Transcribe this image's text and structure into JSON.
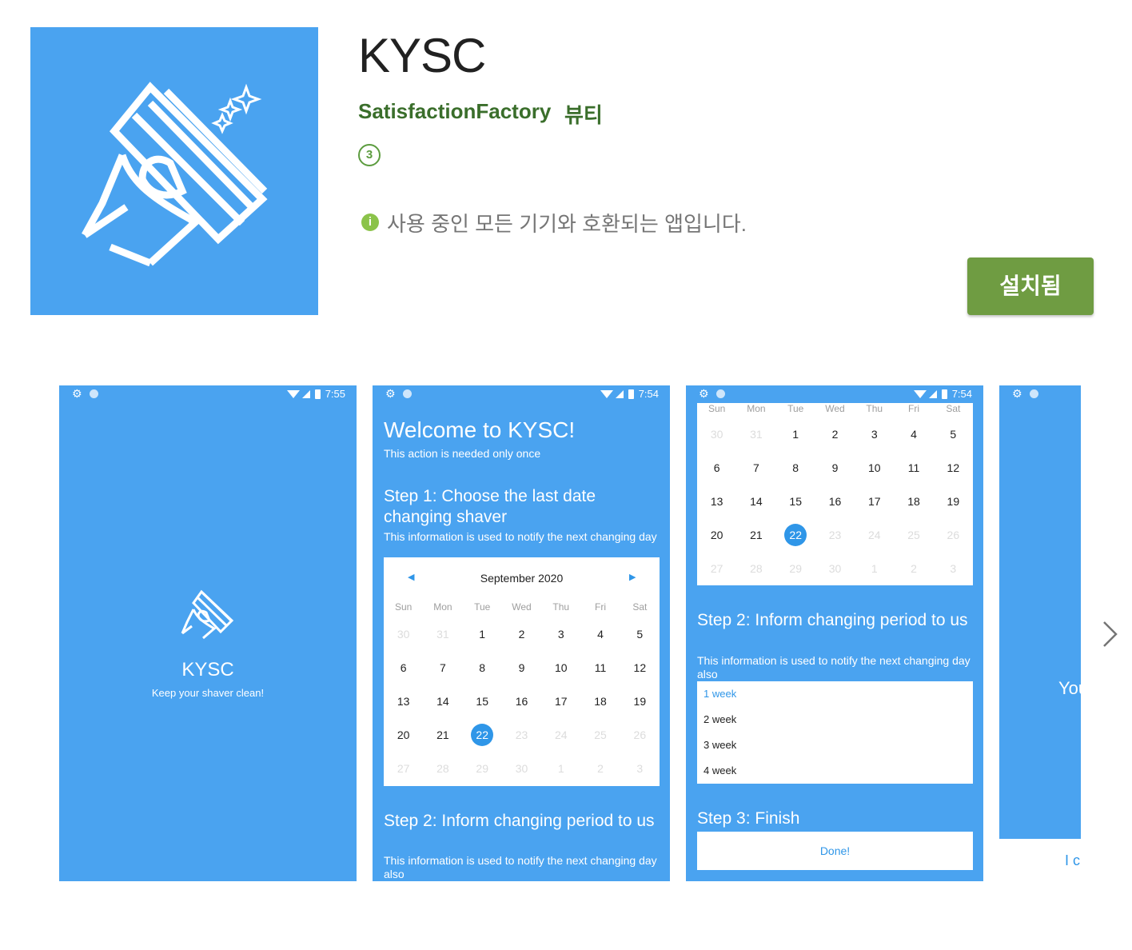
{
  "app": {
    "title": "KYSC",
    "developer": "SatisfactionFactory",
    "category": "뷰티",
    "rating_badge": "3",
    "compat_icon": "i",
    "compat_text": "사용 중인 모든 기기와 호환되는 앱입니다.",
    "install_label": "설치됨",
    "icon_name": "razor-icon",
    "colors": {
      "accent": "#4aa3f0",
      "developer_green": "#3a6e2b",
      "install_green": "#6f9c42"
    }
  },
  "screenshots": [
    {
      "time": "7:55",
      "app_name": "KYSC",
      "tagline": "Keep your shaver clean!"
    },
    {
      "time": "7:54",
      "welcome": "Welcome to KYSC!",
      "welcome_sub": "This action is needed only once",
      "step1_title": "Step 1: Choose the last date changing shaver",
      "step1_desc": "This information is used to notify the next changing day",
      "month": "September 2020",
      "prev_icon": "◀",
      "next_icon": "▶",
      "step2_title": "Step 2: Inform changing period to us",
      "step2_desc": "This information is used to notify the next changing day also"
    },
    {
      "time": "7:54",
      "step2_title": "Step 2: Inform changing period to us",
      "step2_desc": "This information is used to notify the next changing day also",
      "periods": [
        "1 week",
        "2 week",
        "3 week",
        "4 week"
      ],
      "step3_title": "Step 3: Finish",
      "done_label": "Done!"
    },
    {
      "partial_text": "You",
      "partial_caption": "I c"
    }
  ],
  "calendar": {
    "weekdays": [
      "Sun",
      "Mon",
      "Tue",
      "Wed",
      "Thu",
      "Fri",
      "Sat"
    ],
    "selected": "22",
    "weeks": [
      [
        [
          "30",
          1
        ],
        [
          "31",
          1
        ],
        [
          "1",
          0
        ],
        [
          "2",
          0
        ],
        [
          "3",
          0
        ],
        [
          "4",
          0
        ],
        [
          "5",
          0
        ]
      ],
      [
        [
          "6",
          0
        ],
        [
          "7",
          0
        ],
        [
          "8",
          0
        ],
        [
          "9",
          0
        ],
        [
          "10",
          0
        ],
        [
          "11",
          0
        ],
        [
          "12",
          0
        ]
      ],
      [
        [
          "13",
          0
        ],
        [
          "14",
          0
        ],
        [
          "15",
          0
        ],
        [
          "16",
          0
        ],
        [
          "17",
          0
        ],
        [
          "18",
          0
        ],
        [
          "19",
          0
        ]
      ],
      [
        [
          "20",
          0
        ],
        [
          "21",
          0
        ],
        [
          "22",
          2
        ],
        [
          "23",
          1
        ],
        [
          "24",
          1
        ],
        [
          "25",
          1
        ],
        [
          "26",
          1
        ]
      ],
      [
        [
          "27",
          1
        ],
        [
          "28",
          1
        ],
        [
          "29",
          1
        ],
        [
          "30",
          1
        ],
        [
          "1",
          1
        ],
        [
          "2",
          1
        ],
        [
          "3",
          1
        ]
      ]
    ]
  }
}
